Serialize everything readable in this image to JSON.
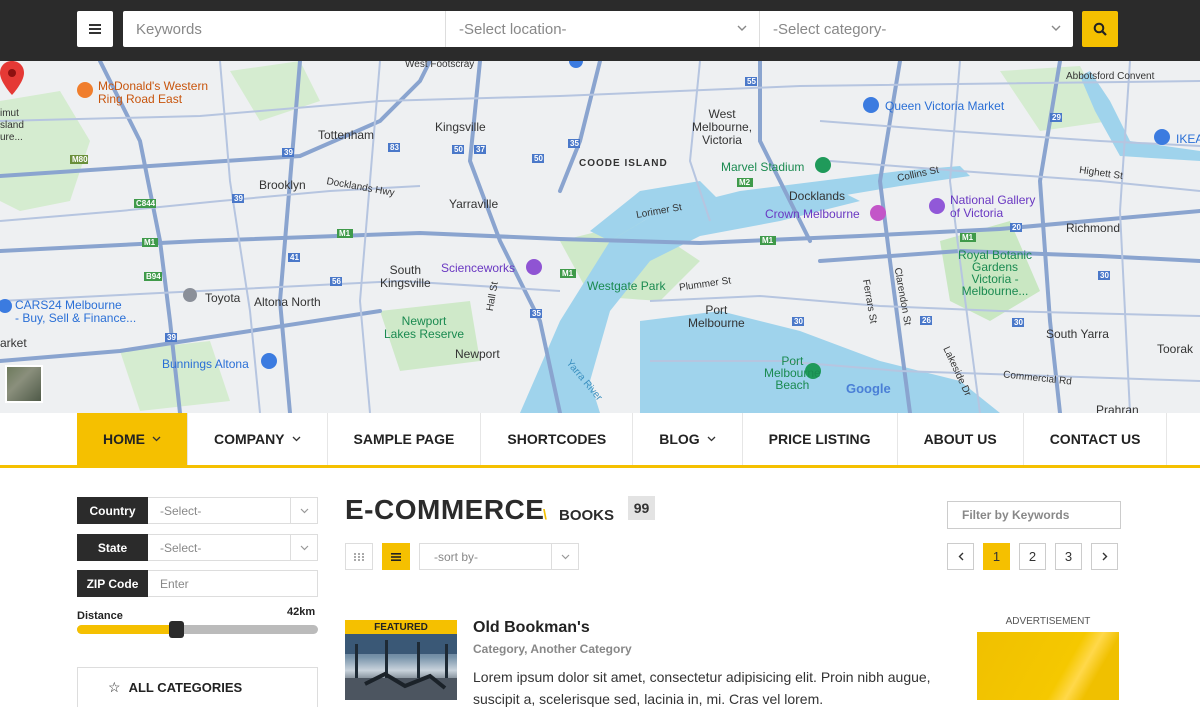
{
  "search": {
    "keywords_placeholder": "Keywords",
    "location_placeholder": "-Select location-",
    "category_placeholder": "-Select category-"
  },
  "map": {
    "labels": {
      "west_footscray": "West\nFootscray",
      "mcdonalds": "McDonald's Western\nRing Road East",
      "imut": "imut\nsland\nure...",
      "tottenham": "Tottenham",
      "kingsville": "Kingsville",
      "brooklyn": "Brooklyn",
      "docklands_hwy": "Docklands Hwy",
      "yarraville": "Yarraville",
      "coode_island": "COODE ISLAND",
      "west_melbourne": "West\nMelbourne,\nVictoria",
      "marvel_stadium": "Marvel Stadium",
      "docklands": "Docklands",
      "crown_melbourne": "Crown Melbourne",
      "queen_victoria": "Queen Victoria Market",
      "abbotsford": "Abbotsford Convent",
      "ikea": "IKEA",
      "collins_st": "Collins St",
      "highett_st": "Highett St",
      "ngv": "National Gallery\nof Victoria",
      "richmond": "Richmond",
      "lorimer_st": "Lorimer St",
      "scienceworks": "Scienceworks",
      "south_kingsville": "South\nKingsville",
      "altona_north": "Altona North",
      "toyota": "Toyota",
      "cars24": "CARS24 Melbourne\n- Buy, Sell & Finance...",
      "westgate_park": "Westgate Park",
      "plummer_st": "Plummer St",
      "port_melbourne": "Port\nMelbourne",
      "royal_botanic": "Royal Botanic\nGardens\nVictoria -\nMelbourne...",
      "south_yarra": "South Yarra",
      "toorak": "Toorak",
      "newport_lakes": "Newport\nLakes Reserve",
      "newport": "Newport",
      "bunnings": "Bunnings Altona",
      "port_melbourne_beach": "Port\nMelbourne\nBeach",
      "commercial_rd": "Commercial Rd",
      "prahran": "Prahran",
      "yarra_river": "Yarra River",
      "hall_st": "Hall St",
      "ferrars_st": "Ferrars St",
      "clarendon_st": "Clarendon St",
      "lakeside_dr": "Lakeside Dr",
      "arket": "arket",
      "google": "Google"
    }
  },
  "nav": {
    "items": [
      {
        "label": "HOME",
        "dropdown": true,
        "active": true
      },
      {
        "label": "COMPANY",
        "dropdown": true,
        "active": false
      },
      {
        "label": "SAMPLE PAGE",
        "dropdown": false,
        "active": false
      },
      {
        "label": "SHORTCODES",
        "dropdown": false,
        "active": false
      },
      {
        "label": "BLOG",
        "dropdown": true,
        "active": false
      },
      {
        "label": "PRICE LISTING",
        "dropdown": false,
        "active": false
      },
      {
        "label": "ABOUT US",
        "dropdown": false,
        "active": false
      },
      {
        "label": "CONTACT US",
        "dropdown": false,
        "active": false
      }
    ]
  },
  "sidebar": {
    "country_label": "Country",
    "country_value": "-Select-",
    "state_label": "State",
    "state_value": "-Select-",
    "zip_label": "ZIP Code",
    "zip_placeholder": "Enter",
    "distance_label": "Distance",
    "distance_value": "42km",
    "distance_fraction": 0.41,
    "all_categories": "ALL CATEGORIES"
  },
  "main": {
    "title": "E-COMMERCE",
    "separator": "\\",
    "subcategory": "BOOKS",
    "count": "99",
    "filter_placeholder": "Filter by Keywords",
    "sort_value": "-sort by-",
    "pages": [
      "1",
      "2",
      "3"
    ],
    "current_page": "1"
  },
  "listing": {
    "badge": "FEATURED",
    "title": "Old Bookman's",
    "categories": "Category, Another Category",
    "description": "Lorem ipsum dolor sit amet, consectetur adipisicing elit. Proin nibh augue, suscipit a, scelerisque sed, lacinia in, mi. Cras vel lorem."
  },
  "ad": {
    "label": "ADVERTISEMENT"
  },
  "colors": {
    "accent": "#f5c000",
    "dark": "#2b2b2b"
  }
}
